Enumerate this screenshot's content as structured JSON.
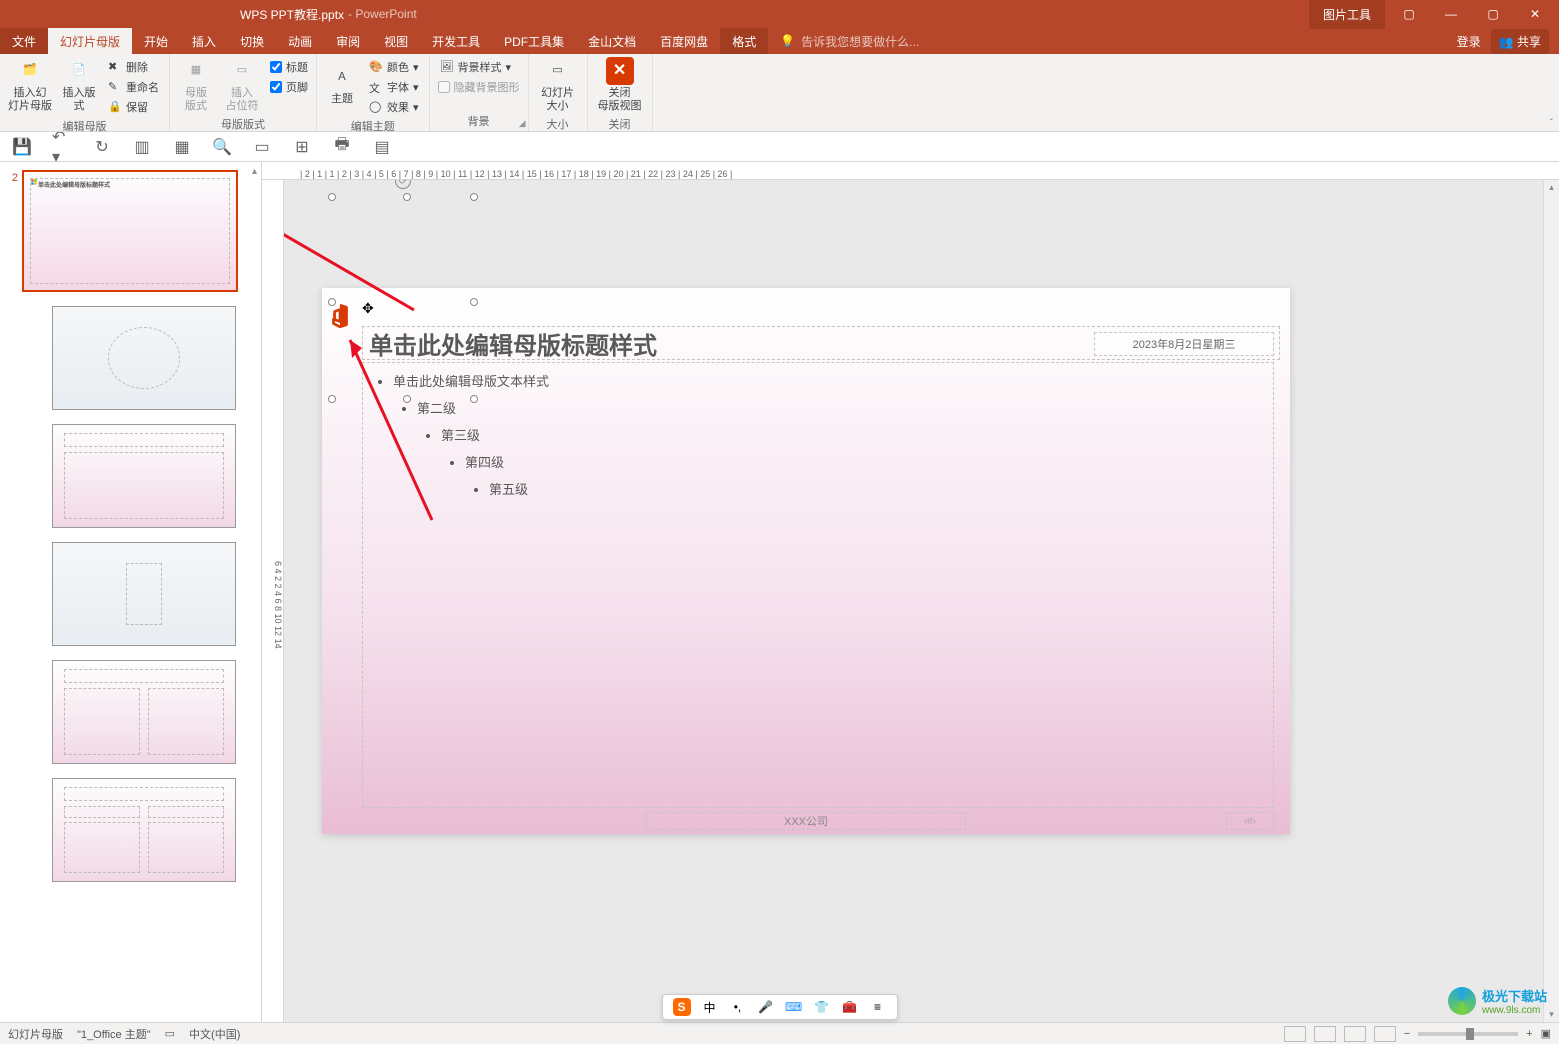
{
  "titlebar": {
    "filename": "WPS PPT教程.pptx",
    "appname": "- PowerPoint",
    "context_tool": "图片工具"
  },
  "window_controls": {
    "ribbon_opts": "▢",
    "min": "—",
    "max": "▢",
    "close": "✕"
  },
  "tabs": {
    "file": "文件",
    "slidemaster": "幻灯片母版",
    "home": "开始",
    "insert": "插入",
    "transitions": "切换",
    "animations": "动画",
    "review": "审阅",
    "view": "视图",
    "devtools": "开发工具",
    "pdftools": "PDF工具集",
    "kingsoft": "金山文档",
    "baidu": "百度网盘",
    "format": "格式",
    "tellme_placeholder": "告诉我您想要做什么...",
    "login": "登录",
    "share": "共享"
  },
  "ribbon": {
    "insert_slide_master": "插入幻\n灯片母版",
    "insert_layout": "插入版式",
    "delete": "删除",
    "rename": "重命名",
    "preserve": "保留",
    "group_edit_master": "编辑母版",
    "master_layout": "母版\n版式",
    "insert_placeholder": "插入\n占位符",
    "chk_title": "标题",
    "chk_footer": "页脚",
    "group_master_layout": "母版版式",
    "themes": "主题",
    "colors": "颜色",
    "fonts": "字体",
    "effects": "效果",
    "group_edit_theme": "编辑主题",
    "bg_styles": "背景样式",
    "hide_bg": "隐藏背景图形",
    "group_bg": "背景",
    "slide_size": "幻灯片\n大小",
    "group_size": "大小",
    "close_master": "关闭\n母版视图",
    "group_close": "关闭"
  },
  "slide": {
    "title_placeholder": "单击此处编辑母版标题样式",
    "body_l1": "单击此处编辑母版文本样式",
    "body_l2": "第二级",
    "body_l3": "第三级",
    "body_l4": "第四级",
    "body_l5": "第五级",
    "date": "2023年8月2日星期三",
    "footer": "XXX公司",
    "slidenum": "‹#›"
  },
  "thumbs": {
    "master_idx": "2"
  },
  "statusbar": {
    "mode": "幻灯片母版",
    "theme": "\"1_Office 主题\"",
    "lang": "中文(中国)",
    "zoom": "+"
  },
  "ime": {
    "mode": "中"
  },
  "watermark": {
    "line1": "极光下载站",
    "line2": "www.9ls.com"
  },
  "ruler_h": "| 2 | 1 | 1 | 2 | 3 | 4 | 5 | 6 | 7 | 8 | 9 | 10 | 11 | 12 | 13 | 14 | 15 | 16 | 17 | 18 | 19 | 20 | 21 | 22 | 23 | 24 | 25 | 26 |"
}
